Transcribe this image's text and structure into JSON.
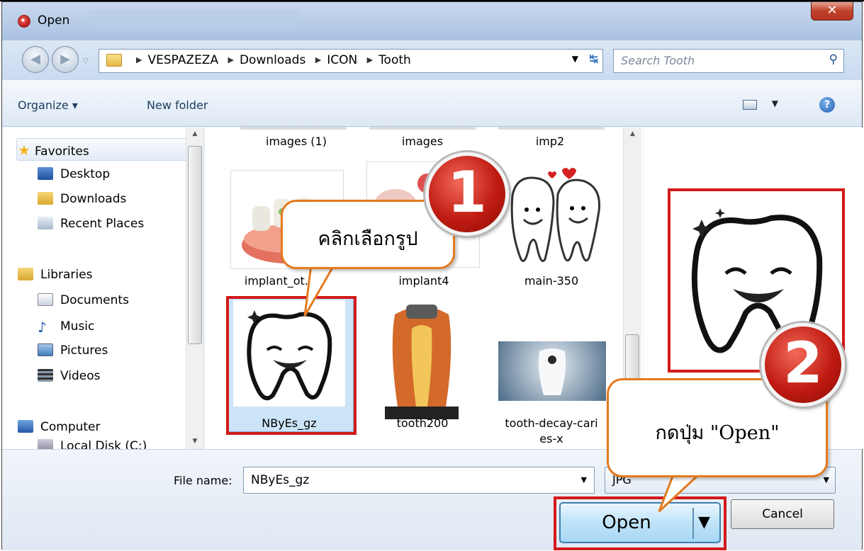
{
  "window": {
    "title": "Open"
  },
  "address": {
    "crumbs": [
      "VESPAZEZA",
      "Downloads",
      "ICON",
      "Tooth"
    ],
    "search_placeholder": "Search Tooth"
  },
  "toolbar": {
    "organize": "Organize ▾",
    "new_folder": "New folder"
  },
  "nav": {
    "favorites": "Favorites",
    "fav_items": [
      "Desktop",
      "Downloads",
      "Recent Places"
    ],
    "libraries": "Libraries",
    "lib_items": [
      "Documents",
      "Music",
      "Pictures",
      "Videos"
    ],
    "computer": "Computer",
    "disk": "Local Disk (C:)"
  },
  "files": {
    "row0": [
      "images (1)",
      "images",
      "imp2"
    ],
    "row1": [
      "implant_ot...",
      "implant4",
      "main-350"
    ],
    "row2": [
      "NByEs_gz",
      "tooth200",
      "tooth-decay-cari",
      "es-x"
    ]
  },
  "bottom": {
    "file_name_label": "File name:",
    "file_name_value": "NByEs_gz",
    "filter": "JPG",
    "open": "Open",
    "cancel": "Cancel"
  },
  "annotations": {
    "step1_number": "1",
    "step1_text": "คลิกเลือกรูป",
    "step2_number": "2",
    "step2_text": "กดปุ่ม \"Open\""
  }
}
